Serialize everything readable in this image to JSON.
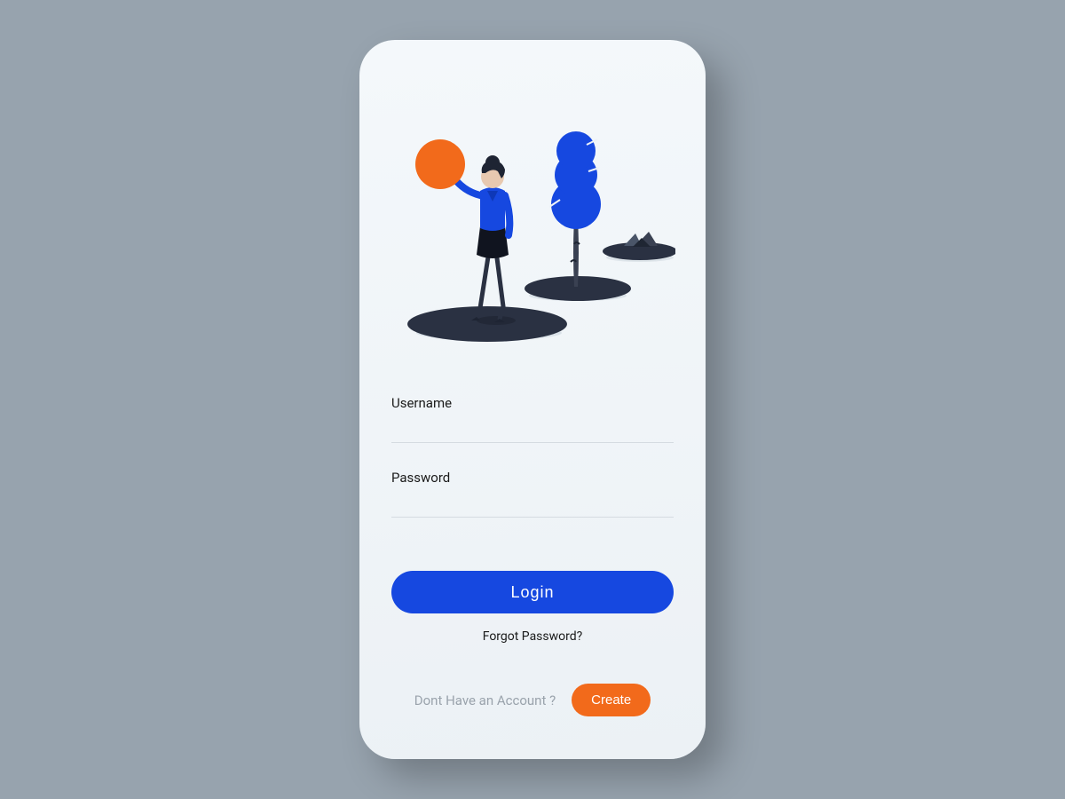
{
  "form": {
    "username_label": "Username",
    "username_value": "",
    "password_label": "Password",
    "password_value": ""
  },
  "actions": {
    "login_label": "Login",
    "forgot_label": "Forgot Password?",
    "no_account_label": "Dont Have an Account ?",
    "create_label": "Create"
  },
  "colors": {
    "primary": "#1648e0",
    "accent": "#f26a1b",
    "dark": "#1e2433"
  }
}
